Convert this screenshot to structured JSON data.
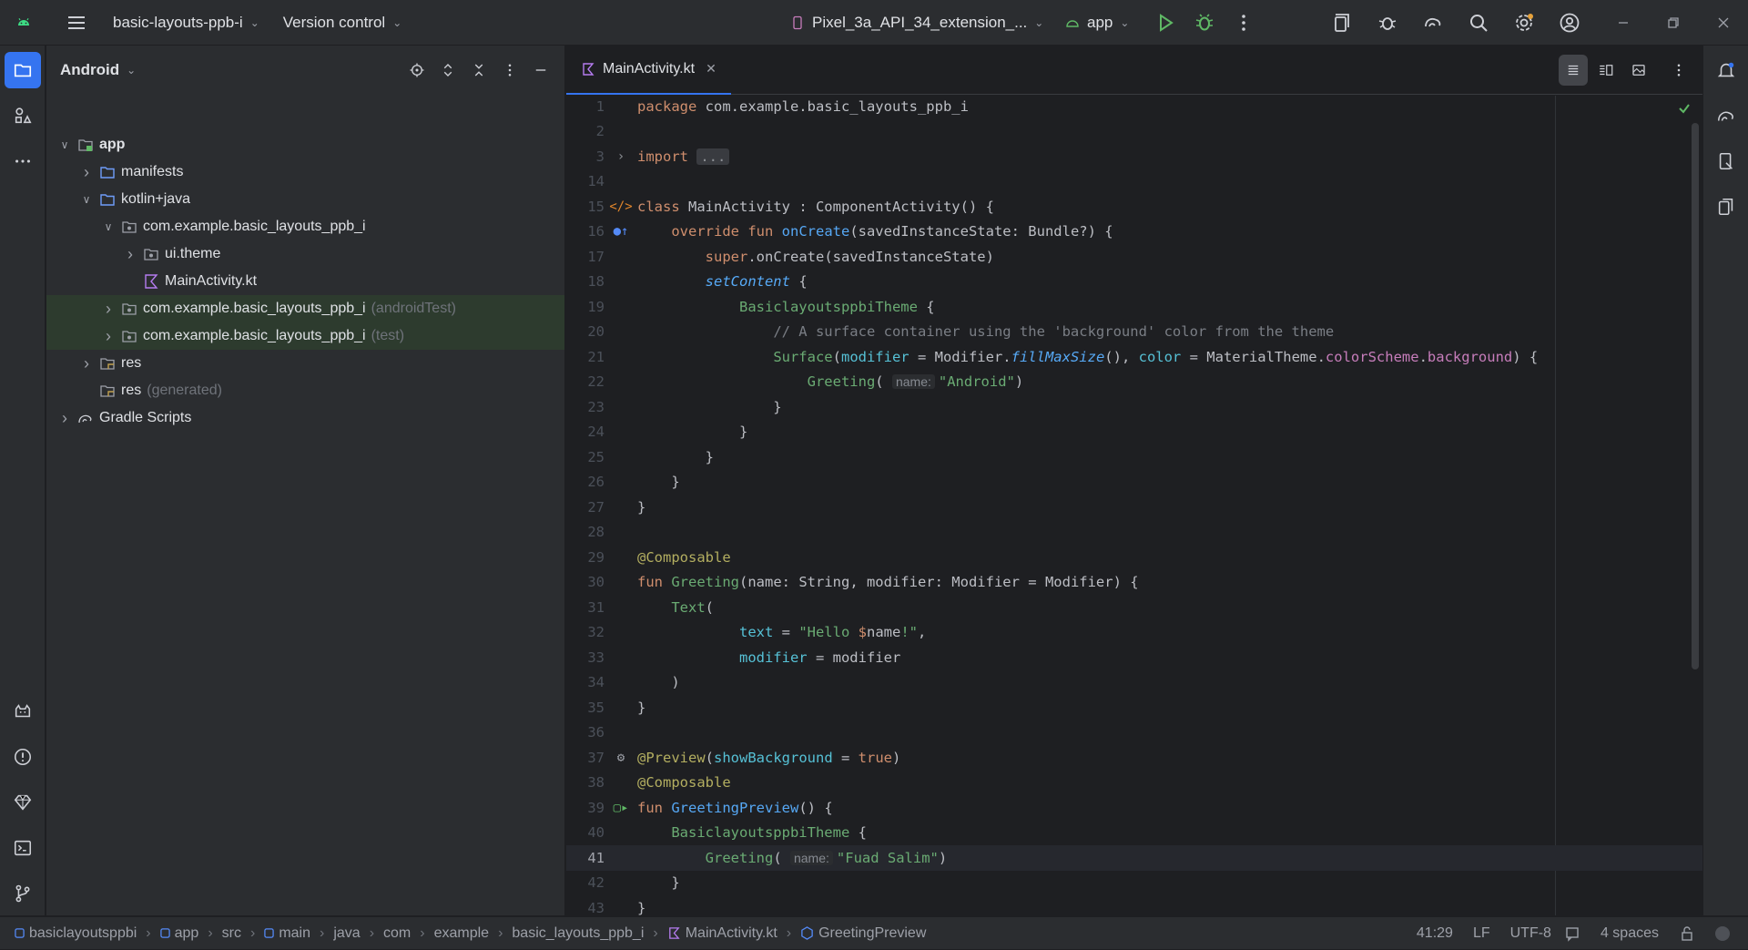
{
  "titlebar": {
    "project_name": "basic-layouts-ppb-i",
    "vcs": "Version control",
    "device": "Pixel_3a_API_34_extension_...",
    "run_config": "app"
  },
  "project_panel": {
    "view_mode": "Android",
    "tree": [
      {
        "label": "app",
        "depth": 0,
        "expanded": true,
        "type": "module"
      },
      {
        "label": "manifests",
        "depth": 1,
        "expanded": false,
        "type": "folder"
      },
      {
        "label": "kotlin+java",
        "depth": 1,
        "expanded": true,
        "type": "folder"
      },
      {
        "label": "com.example.basic_layouts_ppb_i",
        "depth": 2,
        "expanded": true,
        "type": "package"
      },
      {
        "label": "ui.theme",
        "depth": 3,
        "expanded": false,
        "type": "package"
      },
      {
        "label": "MainActivity.kt",
        "depth": 3,
        "type": "kotlin-file"
      },
      {
        "label": "com.example.basic_layouts_ppb_i",
        "suffix": "(androidTest)",
        "depth": 2,
        "expanded": false,
        "type": "package",
        "highlighted": true
      },
      {
        "label": "com.example.basic_layouts_ppb_i",
        "suffix": "(test)",
        "depth": 2,
        "expanded": false,
        "type": "package",
        "highlighted": true
      },
      {
        "label": "res",
        "depth": 1,
        "expanded": false,
        "type": "res-folder"
      },
      {
        "label": "res",
        "suffix": "(generated)",
        "depth": 1,
        "type": "res-folder"
      },
      {
        "label": "Gradle Scripts",
        "depth": 0,
        "expanded": false,
        "type": "gradle"
      }
    ]
  },
  "editor": {
    "tab_label": "MainActivity.kt",
    "current_line": 41,
    "lines": [
      {
        "n": "1",
        "html": "<span class=\"kw\">package</span> com.example.basic_layouts_ppb_i"
      },
      {
        "n": "2",
        "html": ""
      },
      {
        "n": "3",
        "html": "<span class=\"kw\">import</span> <span class=\"fold\">...</span>",
        "gutter": "fold"
      },
      {
        "n": "14",
        "html": ""
      },
      {
        "n": "15",
        "html": "<span class=\"kw\">class</span> MainActivity : ComponentActivity() {",
        "gutter": "code"
      },
      {
        "n": "16",
        "html": "    <span class=\"kw\">override fun</span> <span class=\"fn\">onCreate</span>(savedInstanceState: Bundle?) {",
        "gutter": "override"
      },
      {
        "n": "17",
        "html": "        <span class=\"kw\">super</span>.onCreate(savedInstanceState)"
      },
      {
        "n": "18",
        "html": "        <span class=\"call\">setContent</span> {"
      },
      {
        "n": "19",
        "html": "            <span class=\"str2\">BasiclayoutsppbiTheme</span> {"
      },
      {
        "n": "20",
        "html": "                <span class=\"cm\">// A surface container using the 'background' color from the theme</span>"
      },
      {
        "n": "21",
        "html": "                <span class=\"str2\">Surface</span>(<span class=\"param\">modifier</span> = Modifier.<span class=\"call\">fillMaxSize</span>(), <span class=\"param\">color</span> = MaterialTheme.<span class=\"prop\">colorScheme</span>.<span class=\"prop\">background</span>) {"
      },
      {
        "n": "22",
        "html": "                    <span class=\"str2\">Greeting</span>( <span class=\"hint\">name:</span><span class=\"str\">\"Android\"</span>)"
      },
      {
        "n": "23",
        "html": "                }"
      },
      {
        "n": "24",
        "html": "            }"
      },
      {
        "n": "25",
        "html": "        }"
      },
      {
        "n": "26",
        "html": "    }"
      },
      {
        "n": "27",
        "html": "}"
      },
      {
        "n": "28",
        "html": ""
      },
      {
        "n": "29",
        "html": "<span class=\"ann\">@Composable</span>"
      },
      {
        "n": "30",
        "html": "<span class=\"kw\">fun</span> <span class=\"str2\">Greeting</span>(name: String, modifier: Modifier = Modifier) {"
      },
      {
        "n": "31",
        "html": "    <span class=\"str2\">Text</span>("
      },
      {
        "n": "32",
        "html": "            <span class=\"param\">text</span> = <span class=\"str\">\"Hello </span><span class=\"kw\">$</span><span class=\"cls\">name</span><span class=\"str\">!\"</span>,"
      },
      {
        "n": "33",
        "html": "            <span class=\"param\">modifier</span> = modifier"
      },
      {
        "n": "34",
        "html": "    )"
      },
      {
        "n": "35",
        "html": "}"
      },
      {
        "n": "36",
        "html": ""
      },
      {
        "n": "37",
        "html": "<span class=\"ann\">@Preview</span>(<span class=\"param\">showBackground</span> = <span class=\"kw\">true</span>)",
        "gutter": "gear"
      },
      {
        "n": "38",
        "html": "<span class=\"ann\">@Composable</span>"
      },
      {
        "n": "39",
        "html": "<span class=\"kw\">fun</span> <span class=\"fn\">GreetingPreview</span>() {",
        "gutter": "preview"
      },
      {
        "n": "40",
        "html": "    <span class=\"str2\">BasiclayoutsppbiTheme</span> {"
      },
      {
        "n": "41",
        "html": "        <span class=\"str2\">Greeting</span>( <span class=\"hint\">name:</span><span class=\"str\">\"Fuad Salim\"</span>)"
      },
      {
        "n": "42",
        "html": "    }"
      },
      {
        "n": "43",
        "html": "}"
      }
    ]
  },
  "statusbar": {
    "breadcrumbs": [
      "basiclayoutsppbi",
      "app",
      "src",
      "main",
      "java",
      "com",
      "example",
      "basic_layouts_ppb_i",
      "MainActivity.kt",
      "GreetingPreview"
    ],
    "position": "41:29",
    "line_ending": "LF",
    "encoding": "UTF-8",
    "indent": "4 spaces"
  },
  "colors": {
    "accent": "#3574f0",
    "keyword": "#cf8e6d",
    "string": "#6aab73",
    "composable": "#56a8f5",
    "annotation": "#b3ae60",
    "comment": "#7a7e85"
  }
}
